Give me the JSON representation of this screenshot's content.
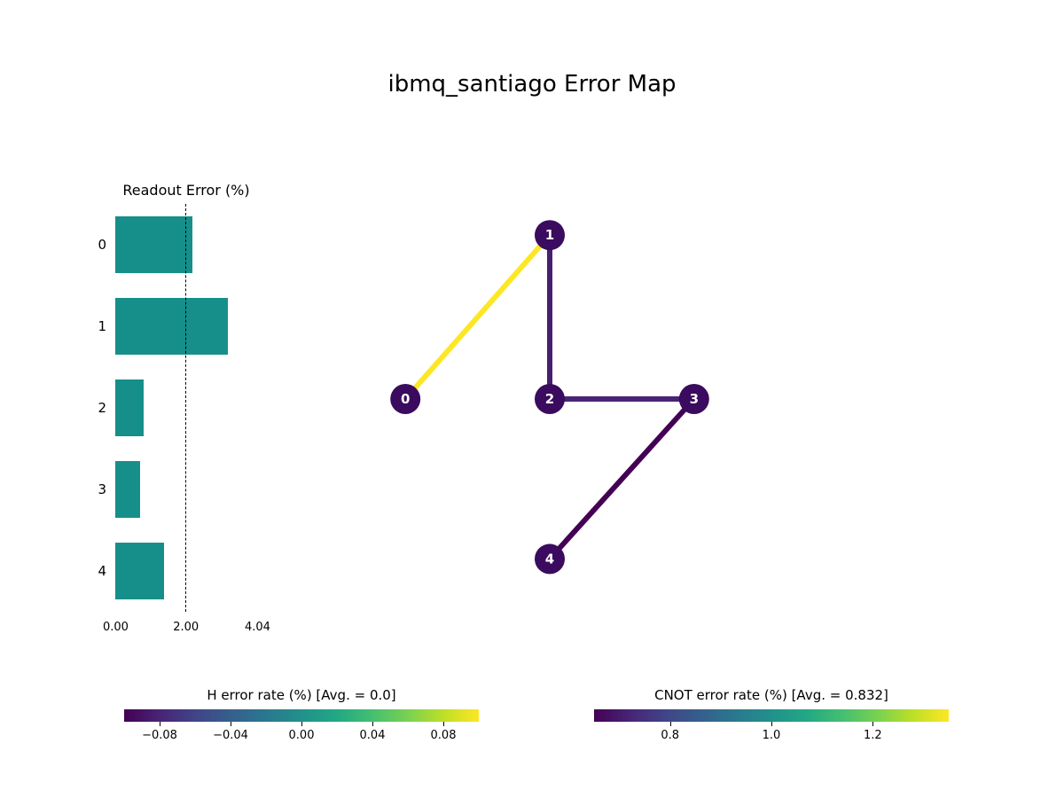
{
  "title": "ibmq_santiago Error Map",
  "chart_data": {
    "readout_error": {
      "type": "bar",
      "orientation": "horizontal",
      "title": "Readout Error (%)",
      "categories": [
        "0",
        "1",
        "2",
        "3",
        "4"
      ],
      "values": [
        2.2,
        3.2,
        0.8,
        0.7,
        1.4
      ],
      "avg": 2.0,
      "xlim": [
        0,
        4.04
      ],
      "xticks": [
        0.0,
        2.0,
        4.04
      ]
    },
    "connectivity": {
      "type": "graph",
      "nodes": [
        {
          "id": 0,
          "x": 0.13,
          "y": 0.5
        },
        {
          "id": 1,
          "x": 0.5,
          "y": 0.08
        },
        {
          "id": 2,
          "x": 0.5,
          "y": 0.5
        },
        {
          "id": 3,
          "x": 0.87,
          "y": 0.5
        },
        {
          "id": 4,
          "x": 0.5,
          "y": 0.91
        }
      ],
      "edges": [
        {
          "source": 0,
          "target": 1,
          "value": 1.35,
          "color": "#fde725"
        },
        {
          "source": 1,
          "target": 2,
          "value": 0.7,
          "color": "#481f70"
        },
        {
          "source": 2,
          "target": 3,
          "value": 0.78,
          "color": "#482475"
        },
        {
          "source": 3,
          "target": 4,
          "value": 0.66,
          "color": "#440154"
        }
      ],
      "node_color": "#3a0b5e"
    },
    "h_error_colorbar": {
      "title": "H error rate (%) [Avg. = 0.0]",
      "ticks": [
        -0.08,
        -0.04,
        0.0,
        0.04,
        0.08
      ],
      "range": [
        -0.1,
        0.1
      ]
    },
    "cnot_error_colorbar": {
      "title": "CNOT error rate (%) [Avg. = 0.832]",
      "ticks": [
        0.8,
        1.0,
        1.2
      ],
      "range": [
        0.65,
        1.35
      ]
    }
  },
  "bar_xtick_labels": [
    "0.00",
    "2.00",
    "4.04"
  ],
  "h_tick_labels": [
    "−0.08",
    "−0.04",
    "0.00",
    "0.04",
    "0.08"
  ],
  "cnot_tick_labels": [
    "0.8",
    "1.0",
    "1.2"
  ]
}
